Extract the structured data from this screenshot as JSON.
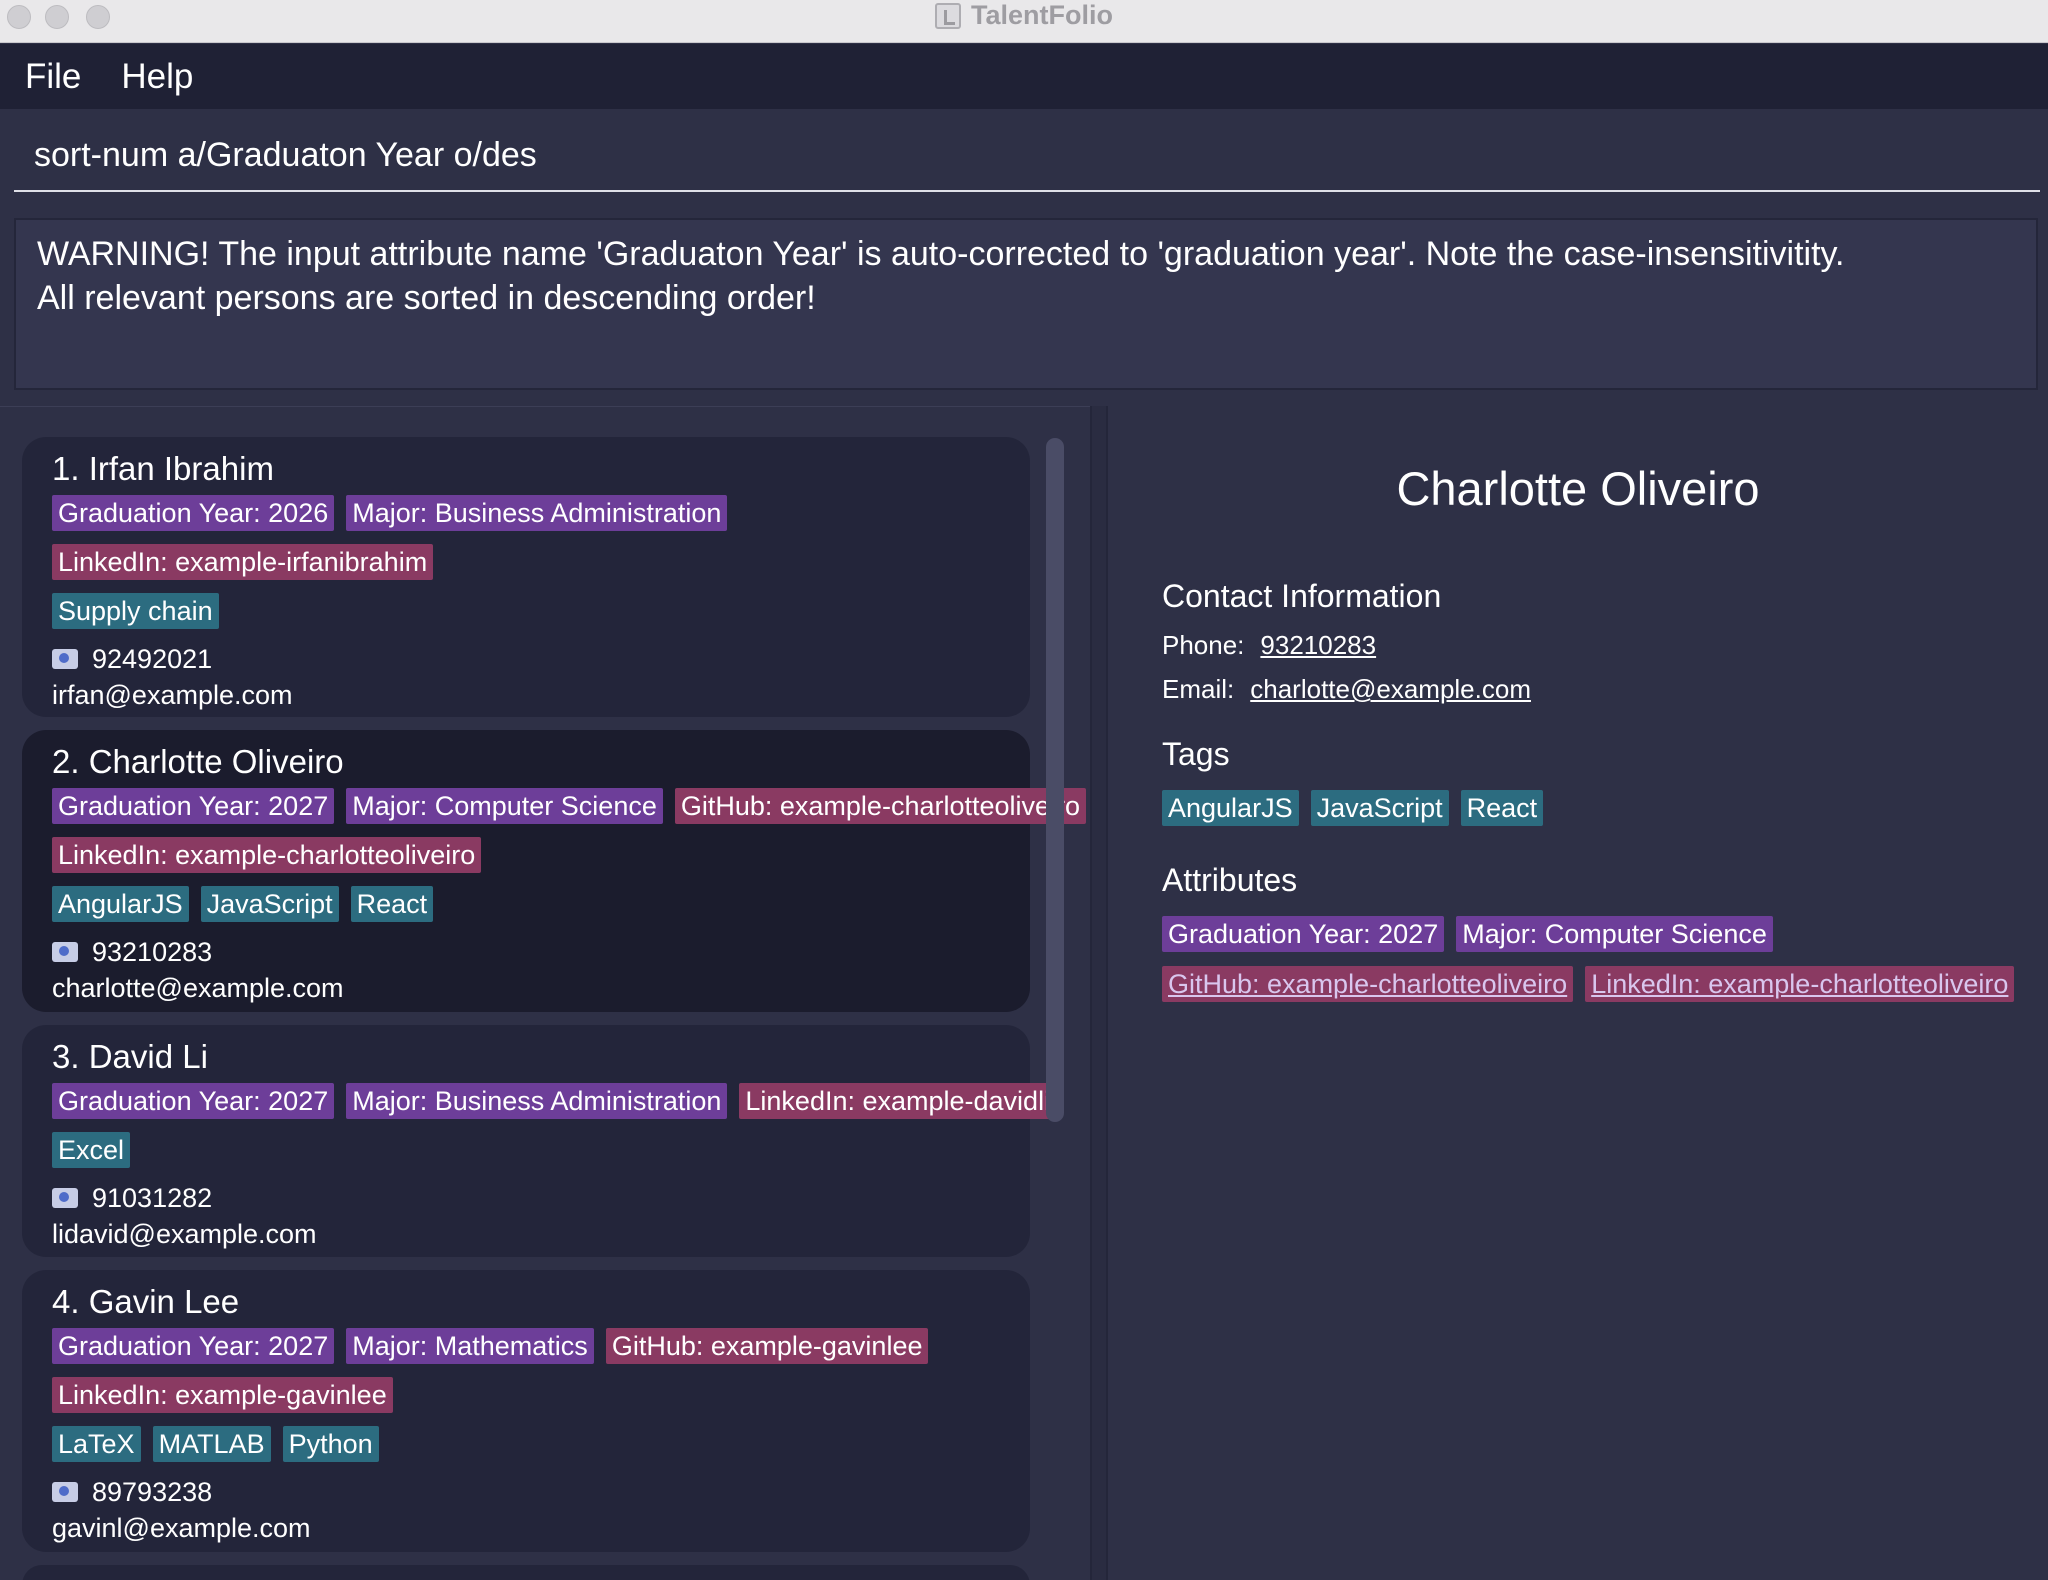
{
  "window": {
    "title": "TalentFolio"
  },
  "menu": {
    "file": "File",
    "help": "Help"
  },
  "command": {
    "value": "sort-num a/Graduaton Year o/des"
  },
  "result": {
    "line1": "WARNING! The input attribute name 'Graduaton Year' is auto-corrected to 'graduation year'. Note the case-insensitivitity.",
    "line2": "All relevant persons are sorted in descending order!"
  },
  "persons": [
    {
      "name": "1. Irfan Ibrahim",
      "attr_row1": [
        "Graduation Year: 2026",
        "Major: Business Administration"
      ],
      "attr_row2": [
        "LinkedIn: example-irfanibrahim"
      ],
      "tags": [
        "Supply chain"
      ],
      "phone": "92492021",
      "email": "irfan@example.com"
    },
    {
      "name": "2. Charlotte Oliveiro",
      "attr_row1": [
        "Graduation Year: 2027",
        "Major: Computer Science",
        "GitHub: example-charlotteoliveiro"
      ],
      "attr_row2": [
        "LinkedIn: example-charlotteoliveiro"
      ],
      "tags": [
        "AngularJS",
        "JavaScript",
        "React"
      ],
      "phone": "93210283",
      "email": "charlotte@example.com"
    },
    {
      "name": "3. David Li",
      "attr_row1": [
        "Graduation Year: 2027",
        "Major: Business Administration",
        "LinkedIn: example-davidli"
      ],
      "tags": [
        "Excel"
      ],
      "phone": "91031282",
      "email": "lidavid@example.com"
    },
    {
      "name": "4. Gavin Lee",
      "attr_row1": [
        "Graduation Year: 2027",
        "Major: Mathematics",
        "GitHub: example-gavinlee"
      ],
      "attr_row2": [
        "LinkedIn: example-gavinlee"
      ],
      "tags": [
        "LaTeX",
        "MATLAB",
        "Python"
      ],
      "phone": "89793238",
      "email": "gavinl@example.com"
    }
  ],
  "detail": {
    "name": "Charlotte Oliveiro",
    "contact_title": "Contact Information",
    "phone_label": "Phone:",
    "phone": "93210283",
    "email_label": "Email:",
    "email": "charlotte@example.com",
    "tags_title": "Tags",
    "tags": [
      "AngularJS",
      "JavaScript",
      "React"
    ],
    "attributes_title": "Attributes",
    "attr_row1": [
      "Graduation Year: 2027",
      "Major: Computer Science"
    ],
    "attr_row2": [
      "GitHub: example-charlotteoliveiro",
      "LinkedIn: example-charlotteoliveiro"
    ]
  },
  "colors": {
    "background": "#2e3046",
    "menubar": "#1f2135",
    "card": "#23253a",
    "card_selected": "#1b1c2d",
    "chip_purple": "#6d3e99",
    "chip_pink": "#8a3a62",
    "chip_teal": "#2c6c80"
  }
}
